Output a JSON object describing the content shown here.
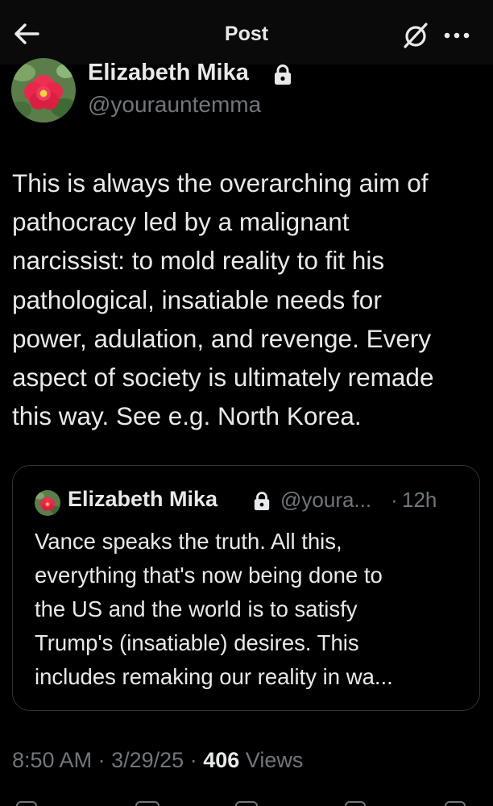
{
  "header": {
    "title": "Post",
    "back_icon": "arrow-left-icon",
    "grok_icon": "grok-icon",
    "more_icon": "more-horizontal-icon"
  },
  "post": {
    "author_name": "Elizabeth Mika",
    "author_handle": "@yourauntemma",
    "protected_icon": "lock-icon",
    "body_lines": [
      "This is always the overarching aim of",
      "pathocracy led by a malignant",
      "narcissist: to mold reality to fit his",
      "pathological, insatiable needs for",
      "power, adulation, and revenge. Every",
      "aspect of society is ultimately remade",
      "this way. See e.g. North Korea."
    ],
    "time": "8:50 AM",
    "separator": "·",
    "date": "3/29/25",
    "views_count": "406",
    "views_label": "Views"
  },
  "quote": {
    "author_name": "Elizabeth Mika",
    "author_handle": "@youra...",
    "separator": "·",
    "time": "12h",
    "body_lines": [
      "Vance speaks the truth. All this,",
      "everything that's now being done to",
      "the US and the world is to satisfy",
      "Trump's (insatiable) desires. This",
      "includes remaking our reality in wa..."
    ]
  },
  "colors": {
    "background": "#000000",
    "header_background": "#0a0a0a",
    "text_primary": "#e7e9ea",
    "text_secondary": "#71767b",
    "border": "#2f3336",
    "flower_red": "#e8284a",
    "leaf_green": "#4f8a3c"
  }
}
